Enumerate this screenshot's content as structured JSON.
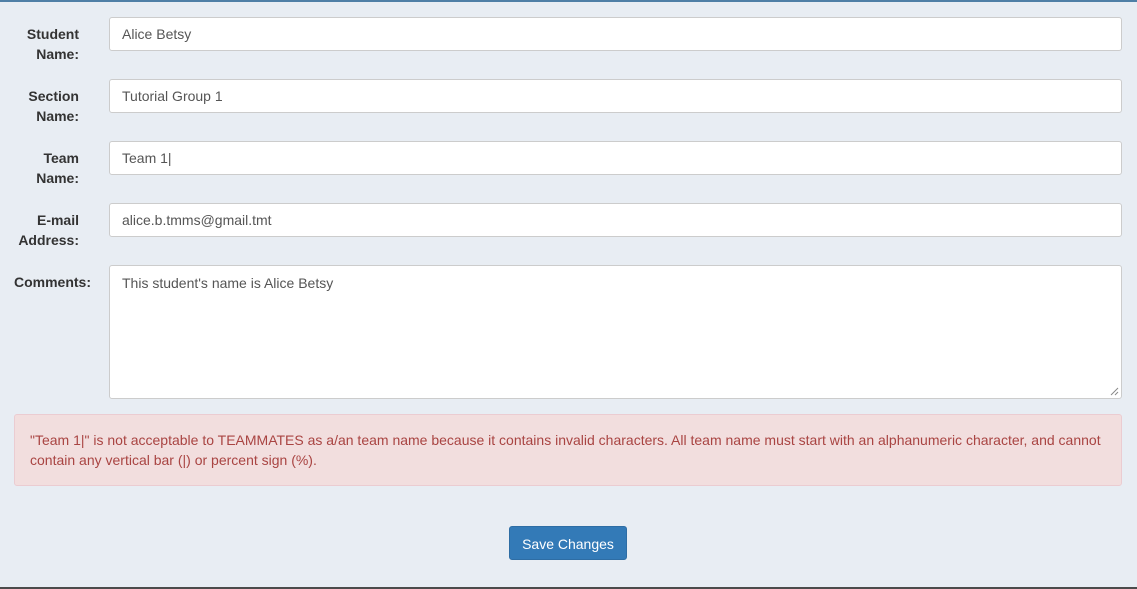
{
  "form": {
    "student_name": {
      "label_line1": "Student",
      "label_line2": "Name:",
      "value": "Alice Betsy"
    },
    "section_name": {
      "label_line1": "Section",
      "label_line2": "Name:",
      "value": "Tutorial Group 1"
    },
    "team_name": {
      "label_line1": "Team",
      "label_line2": "Name:",
      "value": "Team 1|"
    },
    "email": {
      "label_line1": "E-mail",
      "label_line2": "Address:",
      "value": "alice.b.tmms@gmail.tmt"
    },
    "comments": {
      "label": "Comments:",
      "value": "This student's name is Alice Betsy"
    }
  },
  "error": {
    "message": "\"Team 1|\" is not acceptable to TEAMMATES as a/an team name because it contains invalid characters. All team name must start with an alphanumeric character, and cannot contain any vertical bar (|) or percent sign (%)."
  },
  "actions": {
    "save_label": "Save Changes"
  },
  "colors": {
    "background": "#e8edf3",
    "error_bg": "#f2dede",
    "error_text": "#a94442",
    "primary_button": "#337ab7"
  }
}
